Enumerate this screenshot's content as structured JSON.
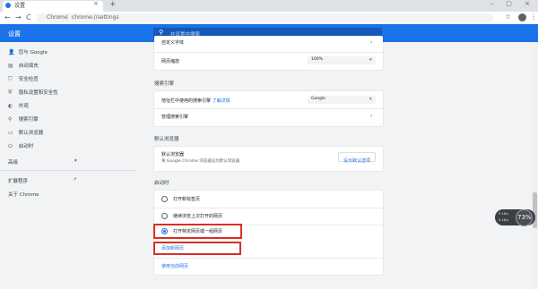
{
  "tab": {
    "title": "设置",
    "close": "×",
    "new_tab": "+"
  },
  "window_controls": "– ▢ ×",
  "toolbar": {
    "back": "←",
    "forward": "→",
    "reload": "C",
    "site_label": "Chrome",
    "separator": "|",
    "url": "chrome://settings"
  },
  "header": {
    "title": "设置",
    "search_placeholder": "在设置中搜索"
  },
  "sidebar": {
    "items": [
      {
        "icon": "person-icon",
        "glyph": "👤",
        "label": "您与 Google"
      },
      {
        "icon": "autofill-icon",
        "glyph": "▤",
        "label": "自动填充"
      },
      {
        "icon": "shield-icon",
        "glyph": "⛉",
        "label": "安全检查"
      },
      {
        "icon": "privacy-icon",
        "glyph": "⛨",
        "label": "隐私设置和安全性"
      },
      {
        "icon": "palette-icon",
        "glyph": "◐",
        "label": "外观"
      },
      {
        "icon": "search-icon",
        "glyph": "⚲",
        "label": "搜索引擎"
      },
      {
        "icon": "browser-icon",
        "glyph": "▭",
        "label": "默认浏览器"
      },
      {
        "icon": "power-icon",
        "glyph": "⏻",
        "label": "启动时"
      }
    ],
    "advanced": {
      "label": "高级",
      "caret": "▾"
    },
    "extensions": {
      "label": "扩展程序",
      "icon": "external-link-icon",
      "glyph": "↗"
    },
    "about": {
      "label": "关于 Chrome"
    }
  },
  "appearance": {
    "font_row": "自定义字体",
    "zoom_label": "网页缩放",
    "zoom_value": "100%"
  },
  "search_engine": {
    "section_title": "搜索引擎",
    "address_bar_label": "地址栏中使用的搜索引擎",
    "learn_more": "了解详情",
    "engine_value": "Google",
    "manage_label": "管理搜索引擎"
  },
  "default_browser": {
    "section_title": "默认浏览器",
    "title": "默认浏览器",
    "subtitle": "将 Google Chrome 浏览器设为默认浏览器",
    "button": "设为默认选项"
  },
  "startup": {
    "section_title": "启动时",
    "options": [
      {
        "label": "打开新标签页",
        "selected": false
      },
      {
        "label": "继续浏览上次打开的网页",
        "selected": false
      },
      {
        "label": "打开特定网页或一组网页",
        "selected": true
      }
    ],
    "add_page": "添加新网页",
    "use_current": "使用当前网页"
  },
  "net_widget": {
    "up": "5.1K/s",
    "down": "0.1K/s",
    "percent": "73%"
  },
  "colors": {
    "accent": "#1a73e8",
    "highlight": "#d93025"
  }
}
